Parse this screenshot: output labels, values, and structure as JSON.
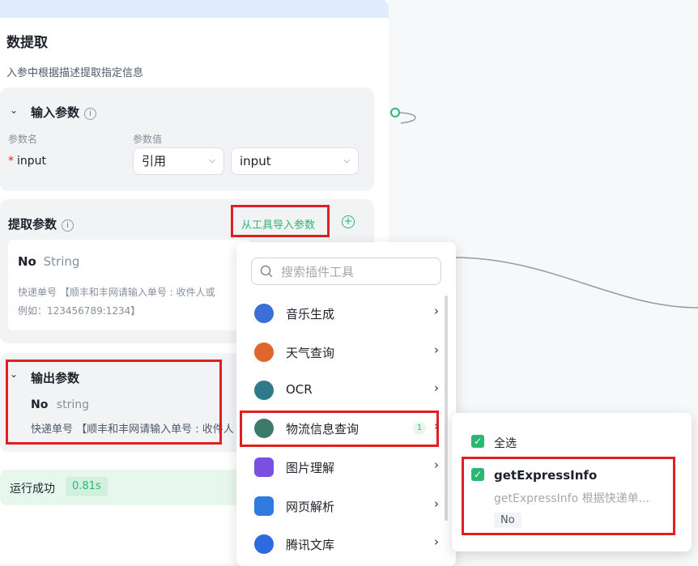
{
  "node": {
    "title": "数提取",
    "subtitle": "入参中根据描述提取指定信息"
  },
  "input_section": {
    "title": "输入参数",
    "col_name": "参数名",
    "col_value": "参数值",
    "required_mark": "*",
    "param_name": "input",
    "ref_select": "引用",
    "value_select": "input"
  },
  "extract_section": {
    "title": "提取参数",
    "import_button": "从工具导入参数",
    "param": {
      "name": "No",
      "type": "String",
      "desc_line1": "快递单号 【顺丰和丰网请输入单号 : 收件人或",
      "desc_line2": "例如：123456789:1234】"
    }
  },
  "output_section": {
    "title": "输出参数",
    "param_name": "No",
    "param_type": "string",
    "desc": "快递单号 【顺丰和丰网请输入单号 : 收件人"
  },
  "status": {
    "text": "运行成功",
    "time": "0.81s"
  },
  "dropdown": {
    "search_placeholder": "搜索插件工具",
    "items": [
      {
        "label": "音乐生成",
        "icon": "music-icon",
        "color": "#3a6fd8"
      },
      {
        "label": "天气查询",
        "icon": "weather-icon",
        "color": "#e0662b"
      },
      {
        "label": "OCR",
        "icon": "ocr-icon",
        "color": "#2f7a8a"
      },
      {
        "label": "物流信息查询",
        "icon": "logistics-icon",
        "color": "#3d7a6a",
        "badge": "1"
      },
      {
        "label": "图片理解",
        "icon": "image-understand-icon",
        "color": "#7b4fe0"
      },
      {
        "label": "网页解析",
        "icon": "web-parse-icon",
        "color": "#2f7ae0"
      },
      {
        "label": "腾讯文库",
        "icon": "tencent-doc-icon",
        "color": "#2f6ae0"
      }
    ]
  },
  "subpanel": {
    "select_all": "全选",
    "tool_name": "getExpressInfo",
    "tool_desc": "getExpressInfo 根据快递单...",
    "tool_tag": "No"
  }
}
